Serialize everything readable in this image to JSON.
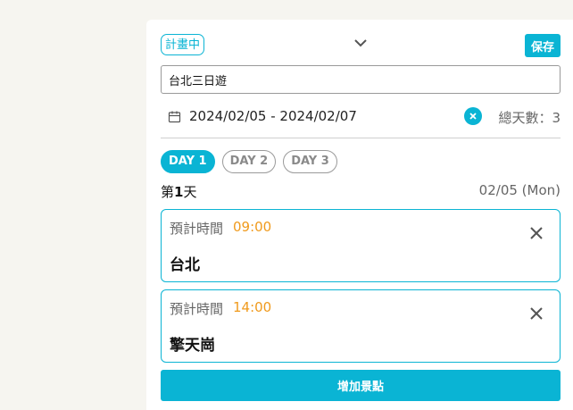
{
  "header": {
    "status_label": "計畫中",
    "save_label": "保存"
  },
  "trip": {
    "name": "台北三日遊",
    "date_range": "2024/02/05 - 2024/02/07",
    "total_days_label": "總天數：3"
  },
  "day_tabs": [
    {
      "label": "DAY 1",
      "active": true
    },
    {
      "label": "DAY 2",
      "active": false
    },
    {
      "label": "DAY 3",
      "active": false
    }
  ],
  "current_day": {
    "title_prefix": "第",
    "number": "1",
    "title_suffix": "天",
    "date": "02/05 (Mon)"
  },
  "spots": [
    {
      "time_label": "預計時間",
      "time": "09:00",
      "name": "台北"
    },
    {
      "time_label": "預計時間",
      "time": "14:00",
      "name": "擎天崗"
    }
  ],
  "add_spot_label": "增加景點",
  "colors": {
    "accent": "#0ab4d4",
    "time": "#f09a1c",
    "background": "#f6f5f0"
  },
  "icons": {
    "collapse": "chevron-down-icon",
    "calendar": "calendar-icon",
    "clear_date": "clear-icon",
    "remove_spot": "close-icon"
  }
}
